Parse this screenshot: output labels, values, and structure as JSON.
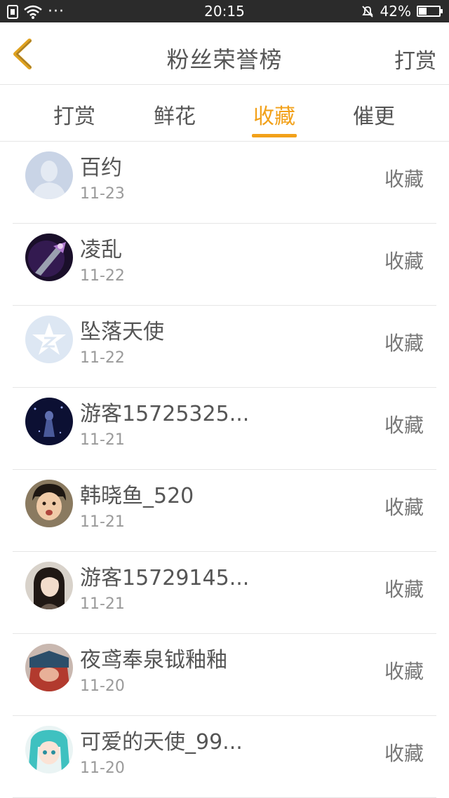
{
  "status_bar": {
    "time": "20:15",
    "battery": "42%",
    "battery_level": 0.42,
    "dots": "···"
  },
  "header": {
    "title": "粉丝荣誉榜",
    "action": "打赏"
  },
  "tabs": [
    {
      "label": "打赏",
      "active": false
    },
    {
      "label": "鲜花",
      "active": false
    },
    {
      "label": "收藏",
      "active": true
    },
    {
      "label": "催更",
      "active": false
    }
  ],
  "fans": [
    {
      "name": "百约",
      "date": "11-23",
      "type": "收藏",
      "avatar": "default-avatar"
    },
    {
      "name": "凌乱",
      "date": "11-22",
      "type": "收藏",
      "avatar": "sword-avatar"
    },
    {
      "name": "坠落天使",
      "date": "11-22",
      "type": "收藏",
      "avatar": "qzone-star-avatar"
    },
    {
      "name": "游客15725325...",
      "date": "11-21",
      "type": "收藏",
      "avatar": "night-figure-avatar"
    },
    {
      "name": "韩晓鱼_520",
      "date": "11-21",
      "type": "收藏",
      "avatar": "boy-photo-avatar"
    },
    {
      "name": "游客15729145...",
      "date": "11-21",
      "type": "收藏",
      "avatar": "girl-photo-avatar"
    },
    {
      "name": "夜鸢奉泉钺釉釉",
      "date": "11-20",
      "type": "收藏",
      "avatar": "anime-red-avatar"
    },
    {
      "name": "可爱的天使_99...",
      "date": "11-20",
      "type": "收藏",
      "avatar": "miku-avatar"
    }
  ],
  "colors": {
    "accent": "#f2a11a",
    "status_bar": "#2b2b2b",
    "text": "#555555",
    "subtext": "#9a9a9a"
  }
}
